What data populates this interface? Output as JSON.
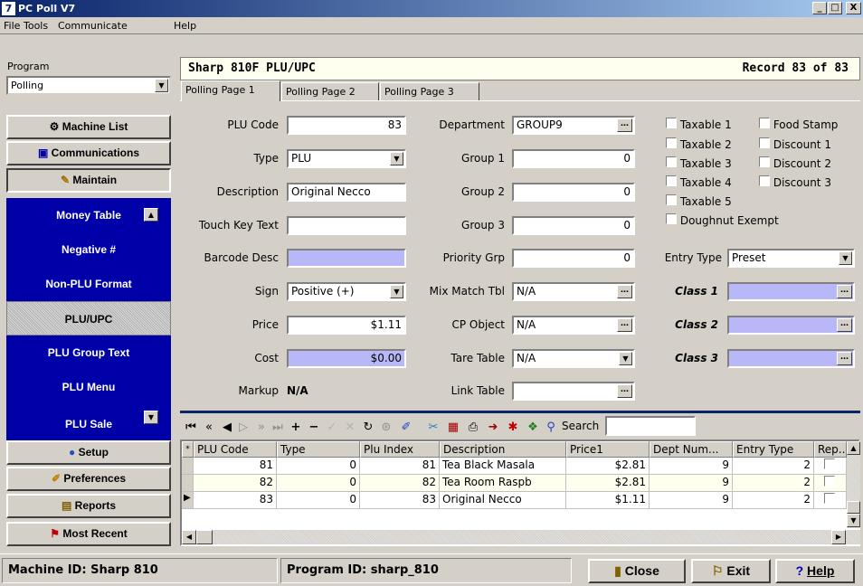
{
  "window": {
    "title": "PC Poll V7",
    "icon": "app-logo-icon",
    "controls": [
      "_",
      "□",
      "X"
    ]
  },
  "menu": [
    "File",
    "Tools",
    "Communicate",
    "Help"
  ],
  "program": {
    "label": "Program",
    "value": "Polling"
  },
  "nav": {
    "top": [
      {
        "label": "Machine List",
        "icon": "gear-icon",
        "glyph": "⚙"
      },
      {
        "label": "Communications",
        "icon": "network-icon",
        "glyph": "▣"
      },
      {
        "label": "Maintain",
        "icon": "wrench-icon",
        "glyph": "✎"
      }
    ],
    "blue": [
      {
        "label": "Money Table"
      },
      {
        "label": "Negative #"
      },
      {
        "label": "Non-PLU Format"
      },
      {
        "label": "PLU/UPC",
        "selected": true
      },
      {
        "label": "PLU Group Text"
      },
      {
        "label": "PLU Menu"
      },
      {
        "label": "PLU Sale"
      }
    ],
    "bottom": [
      {
        "label": "Setup",
        "icon": "globe-icon",
        "glyph": "●"
      },
      {
        "label": "Preferences",
        "icon": "folder-icon",
        "glyph": "✐"
      },
      {
        "label": "Reports",
        "icon": "report-icon",
        "glyph": "▤"
      },
      {
        "label": "Most Recent",
        "icon": "flag-icon",
        "glyph": "⚑"
      }
    ]
  },
  "header": {
    "title": "Sharp 810F PLU/UPC",
    "record": "Record 83 of 83"
  },
  "tabs": [
    "Polling Page 1",
    "Polling Page 2",
    "Polling Page 3"
  ],
  "form": {
    "plu_code": {
      "label": "PLU Code",
      "value": "83"
    },
    "type": {
      "label": "Type",
      "value": "PLU"
    },
    "description": {
      "label": "Description",
      "value": "Original Necco"
    },
    "touch_key": {
      "label": "Touch Key Text",
      "value": ""
    },
    "barcode_desc": {
      "label": "Barcode Desc",
      "value": ""
    },
    "sign": {
      "label": "Sign",
      "value": "Positive (+)"
    },
    "price": {
      "label": "Price",
      "value": "$1.11"
    },
    "cost": {
      "label": "Cost",
      "value": "$0.00"
    },
    "markup": {
      "label": "Markup",
      "value": "N/A"
    },
    "department": {
      "label": "Department",
      "value": "GROUP9"
    },
    "group1": {
      "label": "Group 1",
      "value": "0"
    },
    "group2": {
      "label": "Group 2",
      "value": "0"
    },
    "group3": {
      "label": "Group 3",
      "value": "0"
    },
    "priority": {
      "label": "Priority Grp",
      "value": "0"
    },
    "mixmatch": {
      "label": "Mix Match Tbl",
      "value": "N/A"
    },
    "cpobject": {
      "label": "CP Object",
      "value": "N/A"
    },
    "tare": {
      "label": "Tare Table",
      "value": "N/A"
    },
    "link": {
      "label": "Link Table",
      "value": ""
    },
    "checks": {
      "taxable1": "Taxable 1",
      "taxable2": "Taxable 2",
      "taxable3": "Taxable 3",
      "taxable4": "Taxable 4",
      "taxable5": "Taxable 5",
      "food": "Food Stamp",
      "disc1": "Discount 1",
      "disc2": "Discount 2",
      "disc3": "Discount 3",
      "doughnut": "Doughnut Exempt"
    },
    "entry_type": {
      "label": "Entry Type",
      "value": "Preset"
    },
    "class1": {
      "label": "Class 1",
      "value": ""
    },
    "class2": {
      "label": "Class 2",
      "value": ""
    },
    "class3": {
      "label": "Class 3",
      "value": ""
    }
  },
  "toolbar": {
    "search_label": "Search",
    "search_value": ""
  },
  "grid": {
    "columns": [
      "PLU Code",
      "Type",
      "Plu Index",
      "Description",
      "Price1",
      "Dept Num...",
      "Entry Type",
      "Rep..."
    ],
    "rows": [
      [
        "81",
        "0",
        "81",
        "Tea Black Masala",
        "$2.81",
        "9",
        "2"
      ],
      [
        "82",
        "0",
        "82",
        "Tea Room Raspb",
        "$2.81",
        "9",
        "2"
      ],
      [
        "83",
        "0",
        "83",
        "Original Necco",
        "$1.11",
        "9",
        "2"
      ]
    ]
  },
  "status": {
    "machine": "Machine ID: Sharp 810",
    "program": "Program ID: sharp_810",
    "close": "Close",
    "exit": "Exit",
    "help": "Help"
  }
}
